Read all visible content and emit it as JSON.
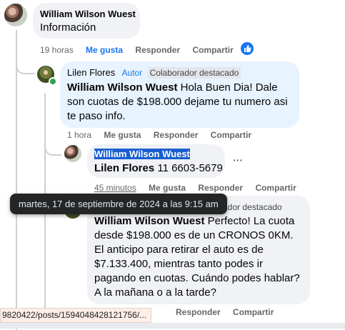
{
  "comment1": {
    "author": "William Wilson Wuest",
    "text": "Información",
    "time": "19 horas",
    "like": "Me gusta",
    "reply": "Responder",
    "share": "Compartir"
  },
  "comment2": {
    "author": "Lilen Flores",
    "author_tag": "Autor",
    "badge": "Colaborador destacado",
    "mention": "William Wilson Wuest",
    "text": " Hola Buen Dia! Dale son cuotas de $198.000 dejame tu numero asi te paso info.",
    "time": "1 hora",
    "like": "Me gusta",
    "reply": "Responder",
    "share": "Compartir"
  },
  "comment3": {
    "mention": "William Wilson Wuest",
    "author": "Lilen Flores",
    "phone": " 11 6603-5679",
    "time": "45 minutos",
    "like": "Me gusta",
    "reply": "Responder",
    "share": "Compartir",
    "more": "···"
  },
  "comment4": {
    "badge_partial": "ador destacado",
    "mention": "William Wilson Wuest",
    "text": " Perfecto! La cuota desde $198.000 es de un CRONOS 0KM. El anticipo para retirar el auto es de $7.133.400, mientras tanto podes ir pagando en cuotas. Cuándo podes hablar? A la mañana o a la tarde?",
    "reply": "Responder",
    "share": "Compartir"
  },
  "tooltip": "martes, 17 de septiembre de 2024 a las 9:15 am",
  "statusbar": "9820422/posts/1594048428121756/...",
  "colors": {
    "link": "#1877f2",
    "bubble": "#f0f2f5",
    "bubble_highlight": "#e7f3ff",
    "selection": "#1a5fd0"
  }
}
